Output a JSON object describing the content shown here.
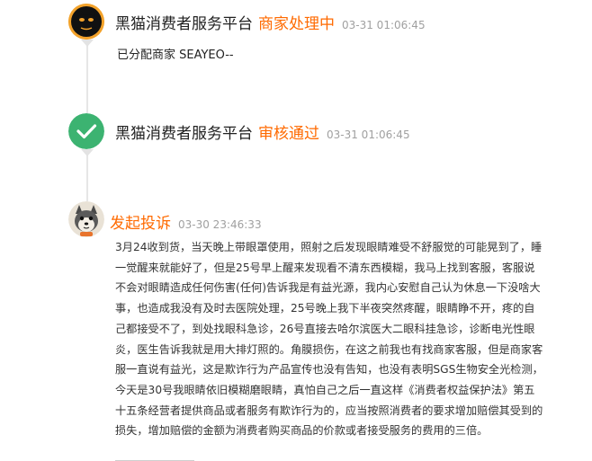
{
  "entries": [
    {
      "platform": "黑猫消费者服务平台",
      "status": "商家处理中",
      "time": "03-31 01:06:45",
      "message": "已分配商家 SEAYEO--",
      "avatar_icon": "black-cat-logo-icon"
    },
    {
      "platform": "黑猫消费者服务平台",
      "status": "审核通过",
      "time": "03-31 01:06:45",
      "avatar_icon": "checkmark-circle-icon"
    },
    {
      "status": "发起投诉",
      "time": "03-30 23:46:33",
      "avatar_icon": "cartoon-dog-avatar-icon",
      "body_lines": [
        "3月24收到货，当天晚上带眼罩使用，照射之后发现眼睛难受不舒服觉的可能晃到了，睡",
        "一觉醒来就能好了，但是25号早上醒来发现看不清东西模糊，我马上找到客服，客服说",
        "不会对眼睛造成任何伤害(任何)告诉我是有益光源，我内心安慰自己认为休息一下没啥大",
        "事，也造成我没有及时去医院处理，25号晚上我下半夜突然疼醒，眼睛睁不开，疼的自",
        "己都接受不了，到处找眼科急诊，26号直接去哈尔滨医大二眼科挂急诊，诊断电光性眼",
        "炎，医生告诉我就是用大排灯照的。角膜损伤，在这之前我也有找商家客服，但是商家客",
        "服一直说有益光，这是欺诈行为产品宣传也没有告知，也没有表明SGS生物安全光检测，",
        "今天是30号我眼睛依旧模糊磨眼睛，真怕自己之后一直这样《消费者权益保护法》第五",
        "十五条经营者提供商品或者服务有欺诈行为的，应当按照消费者的要求增加赔偿其受到的",
        "损失，增加赔偿的金额为消费者购买商品的价款或者接受服务的费用的三倍。"
      ]
    }
  ],
  "colors": {
    "status": "#ff6a00",
    "check_green": "#3cb371",
    "time_gray": "#a0a0a0"
  }
}
